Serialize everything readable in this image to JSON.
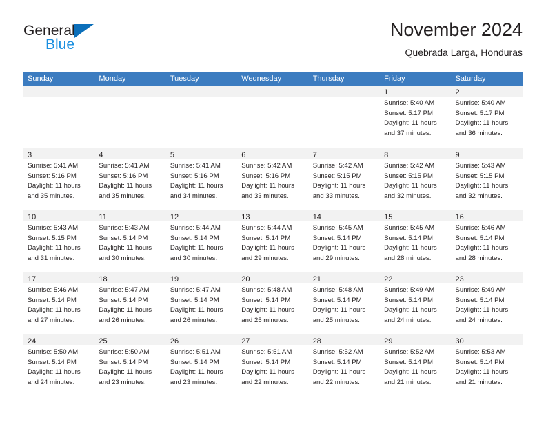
{
  "brand": {
    "name_part1": "General",
    "name_part2": "Blue",
    "triangle_icon": "triangle-icon",
    "color_dark": "#231f20",
    "color_blue": "#1a8fe0",
    "color_triangle": "#0b6fba"
  },
  "header": {
    "month_title": "November 2024",
    "location": "Quebrada Larga, Honduras"
  },
  "theme": {
    "header_bar": "#3c7cc0",
    "daynum_band": "#f2f2f2",
    "text": "#231f20"
  },
  "weekdays": [
    "Sunday",
    "Monday",
    "Tuesday",
    "Wednesday",
    "Thursday",
    "Friday",
    "Saturday"
  ],
  "weeks": [
    [
      {
        "day": "",
        "empty": true,
        "lines": [
          "",
          "",
          "",
          ""
        ]
      },
      {
        "day": "",
        "empty": true,
        "lines": [
          "",
          "",
          "",
          ""
        ]
      },
      {
        "day": "",
        "empty": true,
        "lines": [
          "",
          "",
          "",
          ""
        ]
      },
      {
        "day": "",
        "empty": true,
        "lines": [
          "",
          "",
          "",
          ""
        ]
      },
      {
        "day": "",
        "empty": true,
        "lines": [
          "",
          "",
          "",
          ""
        ]
      },
      {
        "day": "1",
        "empty": false,
        "lines": [
          "Sunrise: 5:40 AM",
          "Sunset: 5:17 PM",
          "Daylight: 11 hours",
          "and 37 minutes."
        ]
      },
      {
        "day": "2",
        "empty": false,
        "lines": [
          "Sunrise: 5:40 AM",
          "Sunset: 5:17 PM",
          "Daylight: 11 hours",
          "and 36 minutes."
        ]
      }
    ],
    [
      {
        "day": "3",
        "empty": false,
        "lines": [
          "Sunrise: 5:41 AM",
          "Sunset: 5:16 PM",
          "Daylight: 11 hours",
          "and 35 minutes."
        ]
      },
      {
        "day": "4",
        "empty": false,
        "lines": [
          "Sunrise: 5:41 AM",
          "Sunset: 5:16 PM",
          "Daylight: 11 hours",
          "and 35 minutes."
        ]
      },
      {
        "day": "5",
        "empty": false,
        "lines": [
          "Sunrise: 5:41 AM",
          "Sunset: 5:16 PM",
          "Daylight: 11 hours",
          "and 34 minutes."
        ]
      },
      {
        "day": "6",
        "empty": false,
        "lines": [
          "Sunrise: 5:42 AM",
          "Sunset: 5:16 PM",
          "Daylight: 11 hours",
          "and 33 minutes."
        ]
      },
      {
        "day": "7",
        "empty": false,
        "lines": [
          "Sunrise: 5:42 AM",
          "Sunset: 5:15 PM",
          "Daylight: 11 hours",
          "and 33 minutes."
        ]
      },
      {
        "day": "8",
        "empty": false,
        "lines": [
          "Sunrise: 5:42 AM",
          "Sunset: 5:15 PM",
          "Daylight: 11 hours",
          "and 32 minutes."
        ]
      },
      {
        "day": "9",
        "empty": false,
        "lines": [
          "Sunrise: 5:43 AM",
          "Sunset: 5:15 PM",
          "Daylight: 11 hours",
          "and 32 minutes."
        ]
      }
    ],
    [
      {
        "day": "10",
        "empty": false,
        "lines": [
          "Sunrise: 5:43 AM",
          "Sunset: 5:15 PM",
          "Daylight: 11 hours",
          "and 31 minutes."
        ]
      },
      {
        "day": "11",
        "empty": false,
        "lines": [
          "Sunrise: 5:43 AM",
          "Sunset: 5:14 PM",
          "Daylight: 11 hours",
          "and 30 minutes."
        ]
      },
      {
        "day": "12",
        "empty": false,
        "lines": [
          "Sunrise: 5:44 AM",
          "Sunset: 5:14 PM",
          "Daylight: 11 hours",
          "and 30 minutes."
        ]
      },
      {
        "day": "13",
        "empty": false,
        "lines": [
          "Sunrise: 5:44 AM",
          "Sunset: 5:14 PM",
          "Daylight: 11 hours",
          "and 29 minutes."
        ]
      },
      {
        "day": "14",
        "empty": false,
        "lines": [
          "Sunrise: 5:45 AM",
          "Sunset: 5:14 PM",
          "Daylight: 11 hours",
          "and 29 minutes."
        ]
      },
      {
        "day": "15",
        "empty": false,
        "lines": [
          "Sunrise: 5:45 AM",
          "Sunset: 5:14 PM",
          "Daylight: 11 hours",
          "and 28 minutes."
        ]
      },
      {
        "day": "16",
        "empty": false,
        "lines": [
          "Sunrise: 5:46 AM",
          "Sunset: 5:14 PM",
          "Daylight: 11 hours",
          "and 28 minutes."
        ]
      }
    ],
    [
      {
        "day": "17",
        "empty": false,
        "lines": [
          "Sunrise: 5:46 AM",
          "Sunset: 5:14 PM",
          "Daylight: 11 hours",
          "and 27 minutes."
        ]
      },
      {
        "day": "18",
        "empty": false,
        "lines": [
          "Sunrise: 5:47 AM",
          "Sunset: 5:14 PM",
          "Daylight: 11 hours",
          "and 26 minutes."
        ]
      },
      {
        "day": "19",
        "empty": false,
        "lines": [
          "Sunrise: 5:47 AM",
          "Sunset: 5:14 PM",
          "Daylight: 11 hours",
          "and 26 minutes."
        ]
      },
      {
        "day": "20",
        "empty": false,
        "lines": [
          "Sunrise: 5:48 AM",
          "Sunset: 5:14 PM",
          "Daylight: 11 hours",
          "and 25 minutes."
        ]
      },
      {
        "day": "21",
        "empty": false,
        "lines": [
          "Sunrise: 5:48 AM",
          "Sunset: 5:14 PM",
          "Daylight: 11 hours",
          "and 25 minutes."
        ]
      },
      {
        "day": "22",
        "empty": false,
        "lines": [
          "Sunrise: 5:49 AM",
          "Sunset: 5:14 PM",
          "Daylight: 11 hours",
          "and 24 minutes."
        ]
      },
      {
        "day": "23",
        "empty": false,
        "lines": [
          "Sunrise: 5:49 AM",
          "Sunset: 5:14 PM",
          "Daylight: 11 hours",
          "and 24 minutes."
        ]
      }
    ],
    [
      {
        "day": "24",
        "empty": false,
        "lines": [
          "Sunrise: 5:50 AM",
          "Sunset: 5:14 PM",
          "Daylight: 11 hours",
          "and 24 minutes."
        ]
      },
      {
        "day": "25",
        "empty": false,
        "lines": [
          "Sunrise: 5:50 AM",
          "Sunset: 5:14 PM",
          "Daylight: 11 hours",
          "and 23 minutes."
        ]
      },
      {
        "day": "26",
        "empty": false,
        "lines": [
          "Sunrise: 5:51 AM",
          "Sunset: 5:14 PM",
          "Daylight: 11 hours",
          "and 23 minutes."
        ]
      },
      {
        "day": "27",
        "empty": false,
        "lines": [
          "Sunrise: 5:51 AM",
          "Sunset: 5:14 PM",
          "Daylight: 11 hours",
          "and 22 minutes."
        ]
      },
      {
        "day": "28",
        "empty": false,
        "lines": [
          "Sunrise: 5:52 AM",
          "Sunset: 5:14 PM",
          "Daylight: 11 hours",
          "and 22 minutes."
        ]
      },
      {
        "day": "29",
        "empty": false,
        "lines": [
          "Sunrise: 5:52 AM",
          "Sunset: 5:14 PM",
          "Daylight: 11 hours",
          "and 21 minutes."
        ]
      },
      {
        "day": "30",
        "empty": false,
        "lines": [
          "Sunrise: 5:53 AM",
          "Sunset: 5:14 PM",
          "Daylight: 11 hours",
          "and 21 minutes."
        ]
      }
    ]
  ]
}
